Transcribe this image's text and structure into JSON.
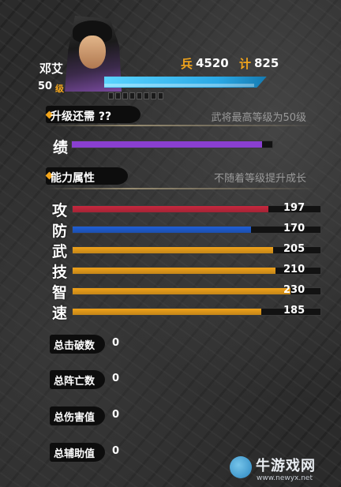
{
  "hero": {
    "name": "邓艾",
    "level": "50",
    "level_unit": "级",
    "soldiers_label": "兵",
    "soldiers": "4520",
    "strategy_label": "计",
    "strategy": "825",
    "xp_fraction": 0.98
  },
  "upgrade": {
    "label": "升级还需 ??",
    "note": "武将最高等级为50级"
  },
  "merit": {
    "label": "绩",
    "fraction": 0.95,
    "color": "#8a3fd0"
  },
  "ability": {
    "label": "能力属性",
    "note": "不随着等级提升成长"
  },
  "stats": [
    {
      "label": "攻",
      "value": "197",
      "fraction": 0.79,
      "color": "#c8283e"
    },
    {
      "label": "防",
      "value": "170",
      "fraction": 0.72,
      "color": "#1f5fd6"
    },
    {
      "label": "武",
      "value": "205",
      "fraction": 0.81,
      "color": "#f0a21a"
    },
    {
      "label": "技",
      "value": "210",
      "fraction": 0.82,
      "color": "#f0a21a"
    },
    {
      "label": "智",
      "value": "230",
      "fraction": 0.88,
      "color": "#f0a21a"
    },
    {
      "label": "速",
      "value": "185",
      "fraction": 0.76,
      "color": "#f0a21a"
    }
  ],
  "totals": [
    {
      "label": "总击破数",
      "value": "0"
    },
    {
      "label": "总阵亡数",
      "value": "0"
    },
    {
      "label": "总伤害值",
      "value": "0"
    },
    {
      "label": "总辅助值",
      "value": "0"
    }
  ],
  "watermark": {
    "text": "牛游戏网",
    "url": "www.newyx.net"
  }
}
